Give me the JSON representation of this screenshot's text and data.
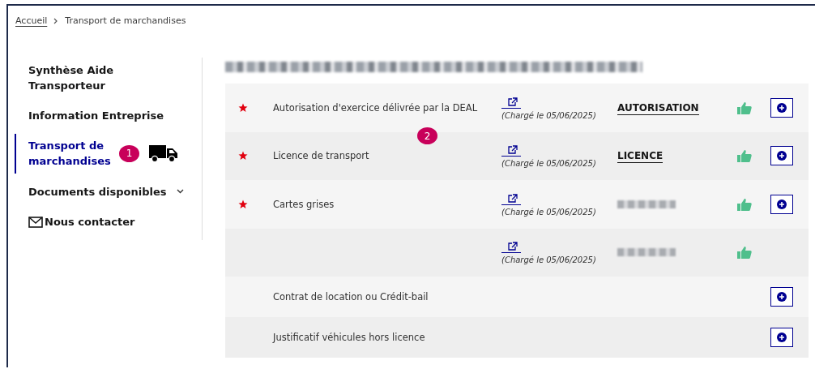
{
  "breadcrumb": [
    {
      "label": "Accueil",
      "kind": "link"
    },
    {
      "label": "Transport de marchandises",
      "kind": "current"
    }
  ],
  "sidebar": {
    "items": [
      {
        "kind": "page",
        "label": "Synthèse Aide Transporteur",
        "selected": false
      },
      {
        "kind": "page",
        "label": "Information Entreprise",
        "selected": false
      },
      {
        "kind": "page",
        "label": "Transport de marchandises",
        "selected": true,
        "annotation": "1"
      },
      {
        "kind": "dropdown",
        "label": "Documents disponibles",
        "selected": false
      },
      {
        "kind": "contact",
        "label": "Nous contacter",
        "selected": false
      }
    ]
  },
  "main": {
    "title": {
      "kind": "redacted"
    },
    "annotation": "2",
    "rows": [
      {
        "required": true,
        "label": "Autorisation d'exercice délivrée par la DEAL",
        "date": "(Chargé le 05/06/2025)",
        "file": {
          "kind": "link",
          "label": "AUTORISATION"
        },
        "approved": true,
        "add_button": true
      },
      {
        "required": true,
        "label": "Licence de transport",
        "date": "(Chargé le 05/06/2025)",
        "file": {
          "kind": "link",
          "label": "LICENCE"
        },
        "approved": true,
        "add_button": true
      },
      {
        "required": true,
        "label": "Cartes grises",
        "date": "(Chargé le 05/06/2025)",
        "file": {
          "kind": "redacted"
        },
        "approved": true,
        "add_button": true
      },
      {
        "required": false,
        "date": "(Chargé le 05/06/2025)",
        "file": {
          "kind": "redacted"
        },
        "approved": true,
        "add_button": false
      },
      {
        "required": false,
        "label": "Contrat de location ou Crédit-bail",
        "approved": false,
        "add_button": true
      },
      {
        "required": false,
        "label": "Justificatif véhicules hors licence",
        "approved": false,
        "add_button": true
      }
    ]
  }
}
